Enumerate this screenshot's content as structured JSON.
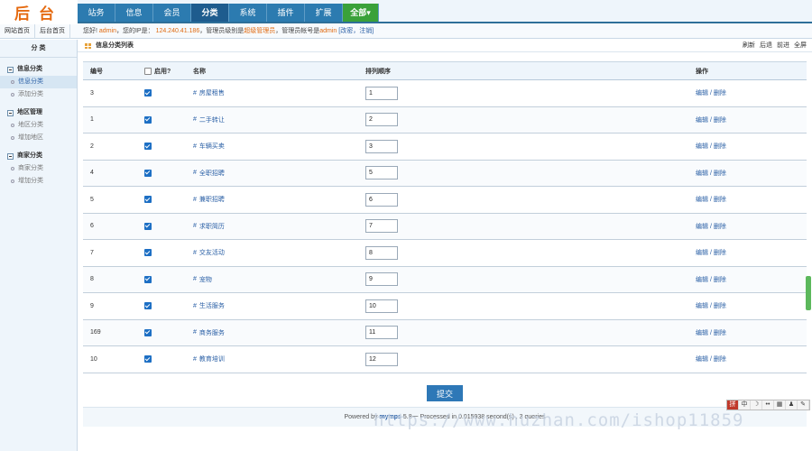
{
  "header": {
    "logo": "后台",
    "nav": [
      {
        "label": "站务",
        "name": "nav-zhanwu"
      },
      {
        "label": "信息",
        "name": "nav-xinxi"
      },
      {
        "label": "会员",
        "name": "nav-huiyuan"
      },
      {
        "label": "分类",
        "name": "nav-fenlei",
        "active": true
      },
      {
        "label": "系统",
        "name": "nav-xitong"
      },
      {
        "label": "插件",
        "name": "nav-chajian"
      },
      {
        "label": "扩展",
        "name": "nav-kuozhan"
      },
      {
        "label": "全部▾",
        "name": "nav-all"
      }
    ]
  },
  "infobar": {
    "links": [
      "网站首页",
      "后台首页"
    ],
    "greeting": "您好!",
    "user": "admin",
    "ip_prefix": "，您的IP是：",
    "ip": "124.240.41.186",
    "role_prefix": "，管理员级别是",
    "role": "超级管理员",
    "account_prefix": "，管理员帐号是",
    "account": "admin",
    "actions": "[改密，注销]"
  },
  "sidebar": {
    "title": "分 类",
    "groups": [
      {
        "title": "信息分类",
        "items": [
          {
            "label": "信息分类",
            "active": true
          },
          {
            "label": "添加分类"
          }
        ]
      },
      {
        "title": "地区管理",
        "items": [
          {
            "label": "地区分类"
          },
          {
            "label": "增加地区"
          }
        ]
      },
      {
        "title": "商家分类",
        "items": [
          {
            "label": "商家分类"
          },
          {
            "label": "增加分类"
          }
        ]
      }
    ]
  },
  "main": {
    "title": "信息分类列表",
    "actions": [
      "刷新",
      "后退",
      "前进",
      "全屏"
    ],
    "columns": {
      "id": "编号",
      "enable": "启用?",
      "name": "名称",
      "order": "排列顺序",
      "op": "操作"
    },
    "rows": [
      {
        "id": "3",
        "name": "房屋租售",
        "order": "1"
      },
      {
        "id": "1",
        "name": "二手转让",
        "order": "2"
      },
      {
        "id": "2",
        "name": "车辆买卖",
        "order": "3"
      },
      {
        "id": "4",
        "name": "全职招聘",
        "order": "5"
      },
      {
        "id": "5",
        "name": "兼职招聘",
        "order": "6"
      },
      {
        "id": "6",
        "name": "求职简历",
        "order": "7"
      },
      {
        "id": "7",
        "name": "交友活动",
        "order": "8"
      },
      {
        "id": "8",
        "name": "宠物",
        "order": "9"
      },
      {
        "id": "9",
        "name": "生活服务",
        "order": "10"
      },
      {
        "id": "169",
        "name": "商务服务",
        "order": "11"
      },
      {
        "id": "10",
        "name": "教育培训",
        "order": "12"
      }
    ],
    "op_label": "编辑 / 删除",
    "submit": "提交"
  },
  "footer": {
    "prefix": "Powered by ",
    "brand": "mymps",
    "rest": " 5.8&#19968; Processed in 0.015938 second(s) , 3 queries"
  },
  "watermark": "https://www.huzhan.com/ishop11859",
  "ime": [
    "拼",
    "中",
    "☽",
    "••",
    "▦",
    "♟",
    "✎"
  ]
}
